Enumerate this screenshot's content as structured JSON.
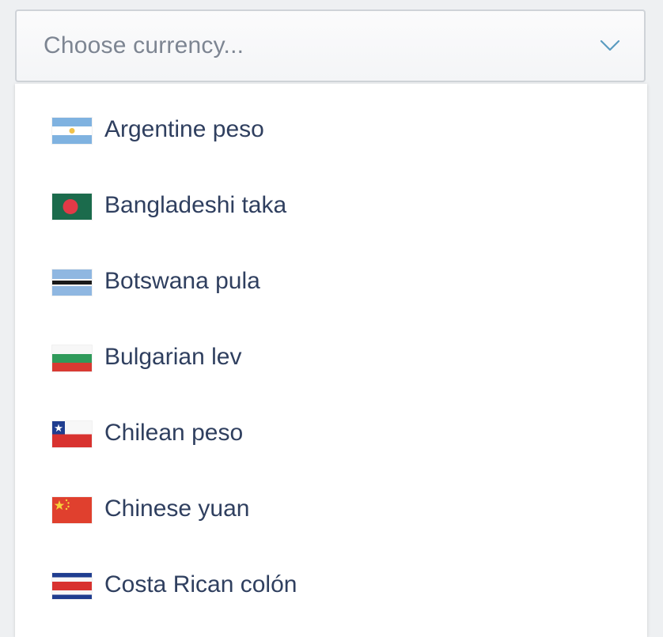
{
  "select": {
    "placeholder": "Choose currency...",
    "chevron_icon": "chevron-down-icon",
    "chevron_color": "#5a9bc0"
  },
  "options": [
    {
      "label": "Argentine peso",
      "flag_icon": "argentina-flag-icon"
    },
    {
      "label": "Bangladeshi taka",
      "flag_icon": "bangladesh-flag-icon"
    },
    {
      "label": "Botswana pula",
      "flag_icon": "botswana-flag-icon"
    },
    {
      "label": "Bulgarian lev",
      "flag_icon": "bulgaria-flag-icon"
    },
    {
      "label": "Chilean peso",
      "flag_icon": "chile-flag-icon"
    },
    {
      "label": "Chinese yuan",
      "flag_icon": "china-flag-icon"
    },
    {
      "label": "Costa Rican colón",
      "flag_icon": "costa-rica-flag-icon"
    }
  ],
  "colors": {
    "text": "#2f3f5f",
    "placeholder": "#7d8592",
    "border": "#cfd3d8"
  }
}
